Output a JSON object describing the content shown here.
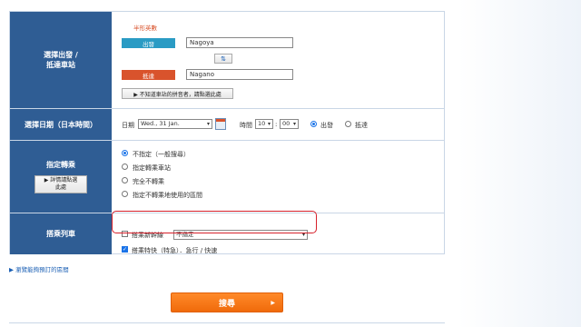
{
  "station": {
    "row_label_line1": "選擇出發 /",
    "row_label_line2": "抵達車站",
    "hint": "半形英數",
    "depart_label": "出發",
    "depart_value": "Nagoya",
    "arrive_label": "抵達",
    "arrive_value": "Nagano",
    "swap_icon": "⇅",
    "kana_help_button": "▶ 不知道車站的拼音者，請點選此處",
    "depart_color": "#2a9bc4",
    "arrive_color": "#d9532c"
  },
  "date": {
    "row_label": "選擇日期（日本時間）",
    "date_label": "日期",
    "date_value": "Wed., 31 Jan.",
    "time_label": "時間",
    "hour_value": "10",
    "minute_value": "00",
    "depart_option": "出發",
    "arrive_option": "抵達"
  },
  "transfer": {
    "row_label": "指定轉乘",
    "details_button_line1": "▶ 詳情請點選",
    "details_button_line2": "此處",
    "options": [
      "不指定（一般搜尋）",
      "指定轉乘車站",
      "完全不轉乘",
      "指定不轉乘地使用的區間"
    ]
  },
  "trains": {
    "row_label": "搭乘列車",
    "shinkansen_label": "搭乘新幹線",
    "shinkansen_select_value": "不指定",
    "express_label": "搭乘特快（特急）．急行 / 快速"
  },
  "link_text": "▶ 瀏覽能夠預訂的區間",
  "search_button": "搜尋",
  "accent_color": "#f07a1a"
}
